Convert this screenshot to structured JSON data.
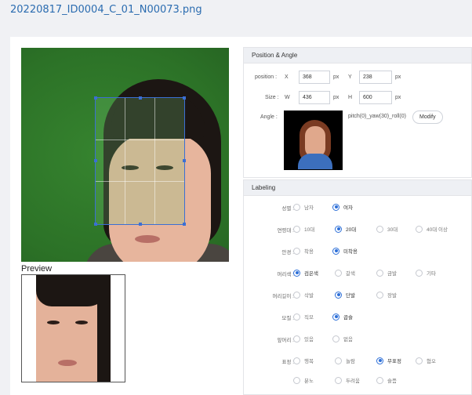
{
  "page_title": "20220817_ID0004_C_01_N00073.png",
  "preview_label": "Preview",
  "position_angle": {
    "header": "Position & Angle",
    "position_label": "position :",
    "x_label": "X",
    "x_value": "368",
    "x_unit": "px",
    "y_label": "Y",
    "y_value": "238",
    "y_unit": "px",
    "size_label": "Size :",
    "w_label": "W",
    "w_value": "436",
    "w_unit": "px",
    "h_label": "H",
    "h_value": "600",
    "h_unit": "px",
    "angle_label": "Angle :",
    "angle_text": "pitch(0)_yaw(30)_roll(0)",
    "modify_label": "Modify"
  },
  "labeling": {
    "header": "Labeling",
    "rows": [
      {
        "label": "성별 :",
        "options": [
          {
            "text": "남자",
            "selected": false
          },
          {
            "text": "여자",
            "selected": true
          }
        ]
      },
      {
        "label": "연령대 :",
        "options": [
          {
            "text": "10대",
            "selected": false
          },
          {
            "text": "20대",
            "selected": true
          },
          {
            "text": "30대",
            "selected": false
          },
          {
            "text": "40대 이상",
            "selected": false
          }
        ]
      },
      {
        "label": "안경 :",
        "options": [
          {
            "text": "착용",
            "selected": false
          },
          {
            "text": "미착용",
            "selected": true
          }
        ]
      },
      {
        "label": "머리색 :",
        "options": [
          {
            "text": "검은색",
            "selected": true
          },
          {
            "text": "갈색",
            "selected": false
          },
          {
            "text": "금발",
            "selected": false
          },
          {
            "text": "기타",
            "selected": false
          }
        ]
      },
      {
        "label": "머리길이 :",
        "options": [
          {
            "text": "삭발",
            "selected": false
          },
          {
            "text": "단발",
            "selected": true
          },
          {
            "text": "장발",
            "selected": false
          }
        ]
      },
      {
        "label": "모질 :",
        "options": [
          {
            "text": "직모",
            "selected": false
          },
          {
            "text": "곱슬",
            "selected": true
          }
        ]
      },
      {
        "label": "앞머리 :",
        "options": [
          {
            "text": "있음",
            "selected": false
          },
          {
            "text": "없음",
            "selected": false
          }
        ]
      },
      {
        "label": "표정 :",
        "options": [
          {
            "text": "행복",
            "selected": false
          },
          {
            "text": "놀람",
            "selected": false
          },
          {
            "text": "무표정",
            "selected": true
          },
          {
            "text": "혐오",
            "selected": false
          }
        ]
      },
      {
        "label": "",
        "options": [
          {
            "text": "분노",
            "selected": false
          },
          {
            "text": "두려움",
            "selected": false
          },
          {
            "text": "슬픔",
            "selected": false
          }
        ]
      }
    ]
  }
}
